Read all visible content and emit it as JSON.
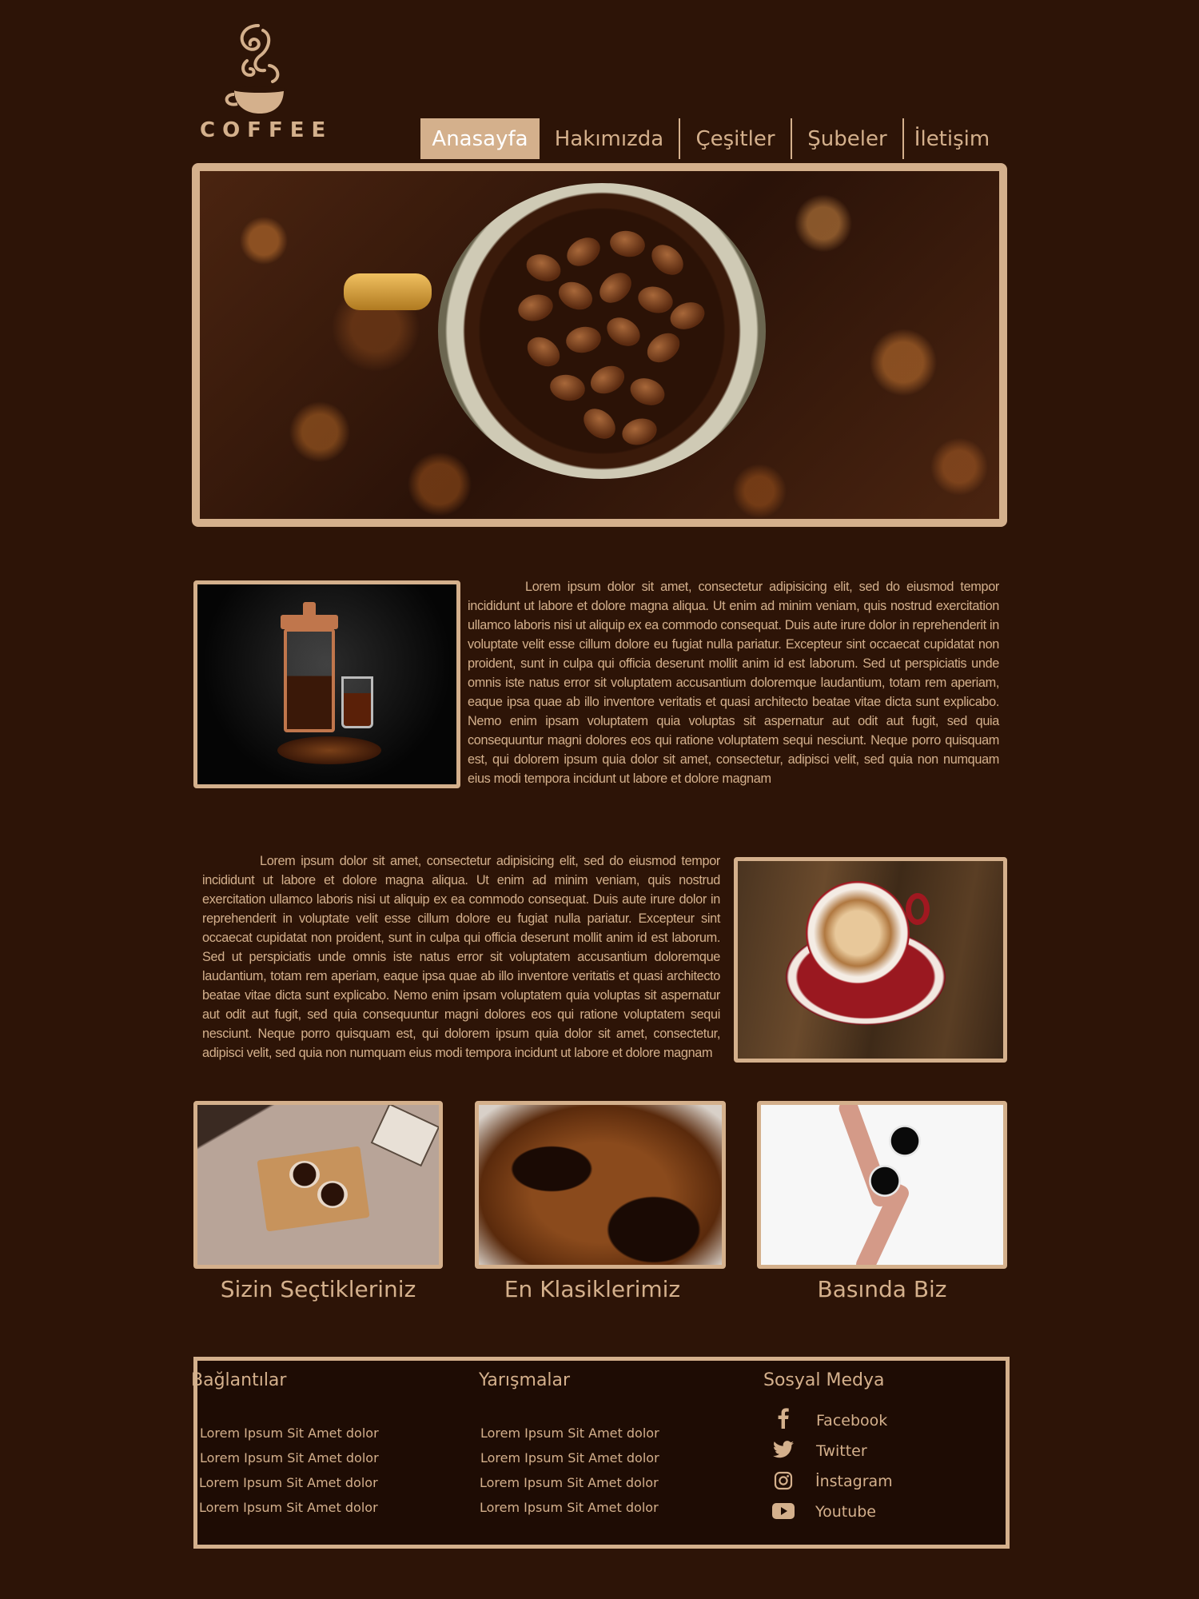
{
  "brand": {
    "logo_text": "COFFEE"
  },
  "nav": {
    "items": [
      {
        "label": "Anasayfa",
        "active": true
      },
      {
        "label": "Hakımızda",
        "active": false
      },
      {
        "label": "Çeşitler",
        "active": false
      },
      {
        "label": "Şubeler",
        "active": false
      },
      {
        "label": "İletişim",
        "active": false
      }
    ]
  },
  "sections": [
    {
      "text": "Lorem ipsum dolor sit amet, consectetur adipisicing elit, sed do eiusmod tempor incididunt ut labore et dolore magna aliqua. Ut enim ad minim veniam, quis nostrud exercitation ullamco laboris nisi ut aliquip ex ea commodo consequat. Duis aute irure dolor in reprehenderit in voluptate velit esse cillum dolore eu fugiat nulla pariatur. Excepteur sint occaecat cupidatat non proident, sunt in culpa qui officia deserunt mollit anim id est laborum. Sed ut perspiciatis unde omnis iste natus error sit voluptatem accusantium doloremque laudantium, totam rem aperiam, eaque ipsa quae ab illo inventore veritatis et quasi architecto beatae vitae dicta sunt explicabo. Nemo enim ipsam voluptatem quia voluptas sit aspernatur aut odit aut fugit, sed quia consequuntur magni dolores eos qui ratione voluptatem sequi nesciunt. Neque porro quisquam est, qui dolorem ipsum quia dolor sit amet, consectetur, adipisci velit, sed quia non numquam eius modi tempora incidunt ut labore et dolore magnam"
    },
    {
      "text": "Lorem ipsum dolor sit amet, consectetur adipisicing elit, sed do eiusmod tempor incididunt ut labore et dolore magna aliqua. Ut enim ad minim veniam, quis nostrud exercitation ullamco laboris nisi ut aliquip ex ea commodo consequat. Duis aute irure dolor in reprehenderit in voluptate velit esse cillum dolore eu fugiat nulla pariatur. Excepteur sint occaecat cupidatat non proident, sunt in culpa qui officia deserunt mollit anim id est laborum. Sed ut perspiciatis unde omnis iste natus error sit voluptatem accusantium doloremque laudantium, totam rem aperiam, eaque ipsa quae ab illo inventore veritatis et quasi architecto beatae vitae dicta sunt explicabo. Nemo enim ipsam voluptatem quia voluptas sit aspernatur aut odit aut fugit, sed quia consequuntur magni dolores eos qui ratione voluptatem sequi nesciunt. Neque porro quisquam est, qui dolorem ipsum quia dolor sit amet, consectetur, adipisci velit, sed quia non numquam eius modi tempora incidunt ut labore et dolore magnam"
    }
  ],
  "cards": [
    {
      "title": "Sizin Seçtikleriniz"
    },
    {
      "title": "En Klasiklerimiz"
    },
    {
      "title": "Basında Biz"
    }
  ],
  "footer": {
    "links": {
      "heading": "Bağlantılar",
      "items": [
        "Lorem Ipsum Sit Amet dolor",
        "Lorem Ipsum Sit Amet dolor",
        "Lorem Ipsum Sit Amet dolor",
        "Lorem Ipsum Sit Amet dolor"
      ]
    },
    "contests": {
      "heading": "Yarışmalar",
      "items": [
        "Lorem Ipsum Sit Amet dolor",
        "Lorem Ipsum Sit Amet dolor",
        "Lorem Ipsum Sit Amet dolor",
        "Lorem Ipsum Sit Amet dolor"
      ]
    },
    "social": {
      "heading": "Sosyal Medya",
      "items": [
        {
          "label": "Facebook",
          "icon": "facebook-icon"
        },
        {
          "label": "Twitter",
          "icon": "twitter-icon"
        },
        {
          "label": "İnstagram",
          "icon": "instagram-icon"
        },
        {
          "label": "Youtube",
          "icon": "youtube-icon"
        }
      ]
    }
  },
  "colors": {
    "background": "#2d1407",
    "accent": "#d4b08c",
    "footer_bg": "#1e0c04"
  }
}
